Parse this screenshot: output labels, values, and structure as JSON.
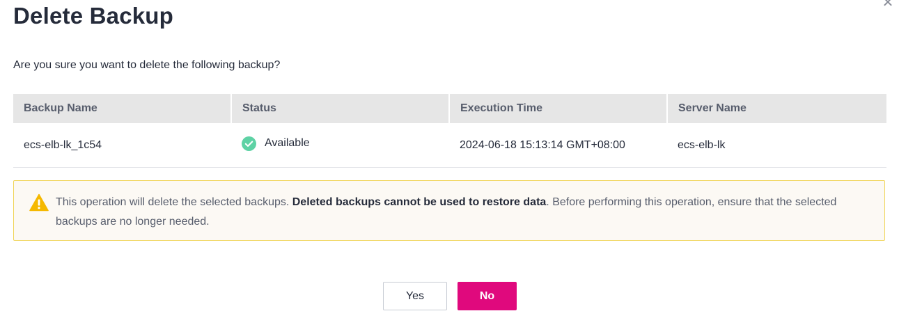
{
  "dialog": {
    "title": "Delete Backup",
    "question": "Are you sure you want to delete the following backup?",
    "close_icon": "close-icon"
  },
  "table": {
    "headers": [
      "Backup Name",
      "Status",
      "Execution Time",
      "Server Name"
    ],
    "rows": [
      {
        "backup_name": "ecs-elb-lk_1c54",
        "status": "Available",
        "status_icon": "check-circle-icon",
        "execution_time": "2024-06-18 15:13:14 GMT+08:00",
        "server_name": "ecs-elb-lk"
      }
    ]
  },
  "warning": {
    "icon": "warning-icon",
    "text_before": "This operation will delete the selected backups. ",
    "text_bold": "Deleted backups cannot be used to restore data",
    "text_after": ". Before performing this operation, ensure that the selected backups are no longer needed."
  },
  "buttons": {
    "yes_label": "Yes",
    "no_label": "No"
  },
  "colors": {
    "primary": "#e0097d",
    "status_ok": "#5ed2a5",
    "warning_border": "#f0d55b",
    "warning_icon": "#f5b800",
    "header_bg": "#e6e6e6"
  }
}
